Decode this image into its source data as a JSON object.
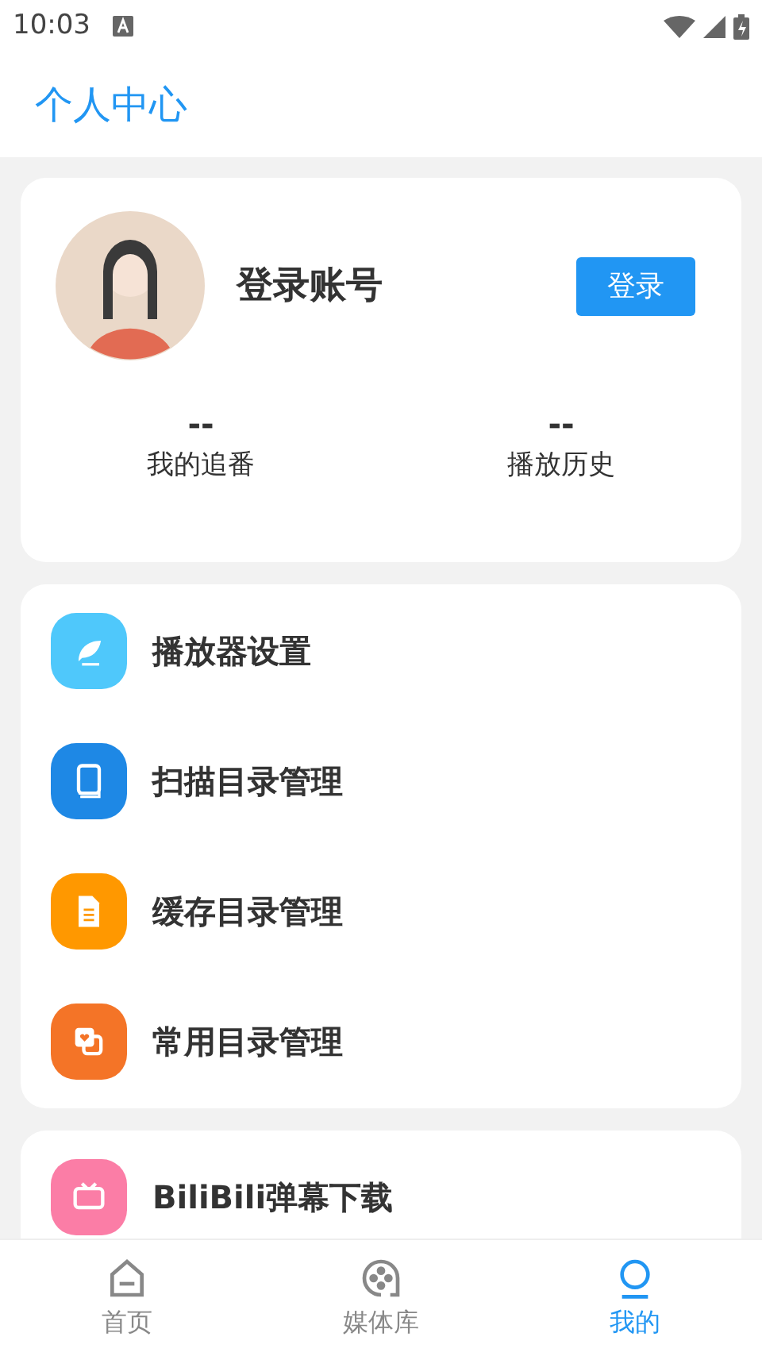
{
  "status_bar": {
    "time": "10:03"
  },
  "header": {
    "title": "个人中心"
  },
  "profile": {
    "name": "登录账号",
    "login_button": "登录",
    "stats": [
      {
        "value": "--",
        "label": "我的追番"
      },
      {
        "value": "--",
        "label": "播放历史"
      }
    ]
  },
  "menu_groups": [
    {
      "items": [
        {
          "kind": "feather",
          "color": "#4fc8fb",
          "label": "播放器设置"
        },
        {
          "kind": "book",
          "color": "#1e88e5",
          "label": "扫描目录管理"
        },
        {
          "kind": "document",
          "color": "#ff9800",
          "label": "缓存目录管理"
        },
        {
          "kind": "heart",
          "color": "#f47427",
          "label": "常用目录管理"
        }
      ]
    },
    {
      "items": [
        {
          "kind": "tv",
          "color": "#fb7da6",
          "label": "BiliBili弹幕下载"
        }
      ]
    }
  ],
  "bottom_nav": [
    {
      "kind": "home",
      "label": "首页",
      "selected": false
    },
    {
      "kind": "film",
      "label": "媒体库",
      "selected": false
    },
    {
      "kind": "user",
      "label": "我的",
      "selected": true
    }
  ]
}
